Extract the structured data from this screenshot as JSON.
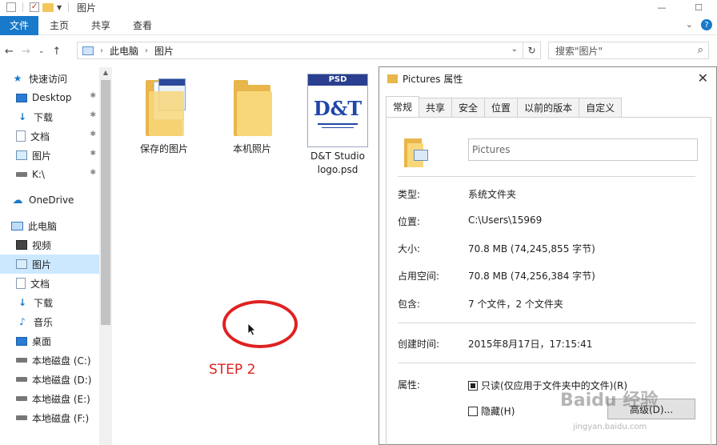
{
  "window": {
    "title": "图片"
  },
  "ribbon": {
    "tabs": [
      "文件",
      "主页",
      "共享",
      "查看"
    ]
  },
  "address": {
    "crumbs": [
      "此电脑",
      "图片"
    ],
    "search_placeholder": "搜索\"图片\""
  },
  "sidebar": {
    "items": [
      {
        "label": "快速访问",
        "icon": "star-icon",
        "indent": 0
      },
      {
        "label": "Desktop",
        "icon": "desktop-icon",
        "indent": 1,
        "pinned": true
      },
      {
        "label": "下载",
        "icon": "download-icon",
        "indent": 1,
        "pinned": true
      },
      {
        "label": "文档",
        "icon": "document-icon",
        "indent": 1,
        "pinned": true
      },
      {
        "label": "图片",
        "icon": "pictures-icon",
        "indent": 1,
        "pinned": true
      },
      {
        "label": "K:\\",
        "icon": "drive-icon",
        "indent": 1,
        "pinned": true
      },
      {
        "label": "OneDrive",
        "icon": "cloud-icon",
        "indent": 0
      },
      {
        "label": "此电脑",
        "icon": "pc-icon",
        "indent": 0
      },
      {
        "label": "视频",
        "icon": "video-icon",
        "indent": 1
      },
      {
        "label": "图片",
        "icon": "pictures-icon",
        "indent": 1,
        "selected": true
      },
      {
        "label": "文档",
        "icon": "document-icon",
        "indent": 1
      },
      {
        "label": "下载",
        "icon": "download-icon",
        "indent": 1
      },
      {
        "label": "音乐",
        "icon": "music-icon",
        "indent": 1
      },
      {
        "label": "桌面",
        "icon": "desktop-icon",
        "indent": 1
      },
      {
        "label": "本地磁盘 (C:)",
        "icon": "drive-icon",
        "indent": 1
      },
      {
        "label": "本地磁盘 (D:)",
        "icon": "drive-icon",
        "indent": 1
      },
      {
        "label": "本地磁盘 (E:)",
        "icon": "drive-icon",
        "indent": 1
      },
      {
        "label": "本地磁盘 (F:)",
        "icon": "drive-icon",
        "indent": 1
      }
    ]
  },
  "files": [
    {
      "label": "保存的图片",
      "kind": "folder-with-docs"
    },
    {
      "label": "本机照片",
      "kind": "folder"
    },
    {
      "label": "D&T Studio logo.psd",
      "kind": "psd",
      "thumb_top": "PSD",
      "thumb_big": "D&T"
    }
  ],
  "annotation": {
    "step_label": "STEP 2",
    "color": "#e02121"
  },
  "dialog": {
    "title": "Pictures 属性",
    "tabs": [
      "常规",
      "共享",
      "安全",
      "位置",
      "以前的版本",
      "自定义"
    ],
    "name_value": "Pictures",
    "rows": [
      {
        "label": "类型:",
        "value": "系统文件夹"
      },
      {
        "label": "位置:",
        "value": "C:\\Users\\15969"
      },
      {
        "label": "大小:",
        "value": "70.8 MB (74,245,855 字节)"
      },
      {
        "label": "占用空间:",
        "value": "70.8 MB (74,256,384 字节)"
      },
      {
        "label": "包含:",
        "value": "7 个文件，2 个文件夹"
      },
      {
        "label": "创建时间:",
        "value": "2015年8月17日，17:15:41"
      }
    ],
    "attributes_label": "属性:",
    "readonly_label": "只读(仅应用于文件夹中的文件)(R)",
    "hidden_label": "隐藏(H)",
    "advanced_button": "高级(D)..."
  },
  "watermark": {
    "text": "Baidu 经验",
    "url_text": "jingyan.baidu.com"
  },
  "accent_color": "#1979ca"
}
